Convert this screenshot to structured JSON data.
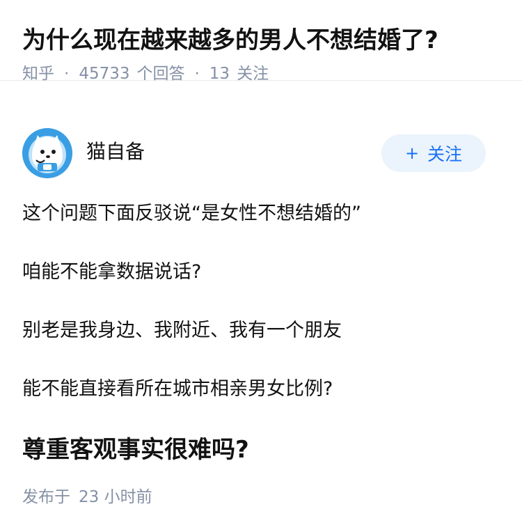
{
  "question": {
    "title": "为什么现在越来越多的男人不想结婚了?",
    "source": "知乎",
    "answer_count": "45733",
    "answer_label": "个回答",
    "follow_count": "13",
    "follow_label": "关注",
    "separator": "·"
  },
  "author": {
    "name": "猫自备",
    "avatar_icon": "cat-astronaut-avatar",
    "follow_button": {
      "plus": "+",
      "label": "关注"
    }
  },
  "answer": {
    "paragraphs": [
      "这个问题下面反驳说“是女性不想结婚的”",
      "咱能不能拿数据说话?",
      "别老是我身边、我附近、我有一个朋友",
      "能不能直接看所在城市相亲男女比例?"
    ],
    "heading": "尊重客观事实很难吗?",
    "posted_label": "发布于",
    "posted_time": "23 小时前"
  },
  "colors": {
    "title": "#121212",
    "meta": "#8590a6",
    "accent": "#1772f6",
    "follow_bg": "#ebf3fc",
    "avatar_bg": "#3a9ee4"
  }
}
